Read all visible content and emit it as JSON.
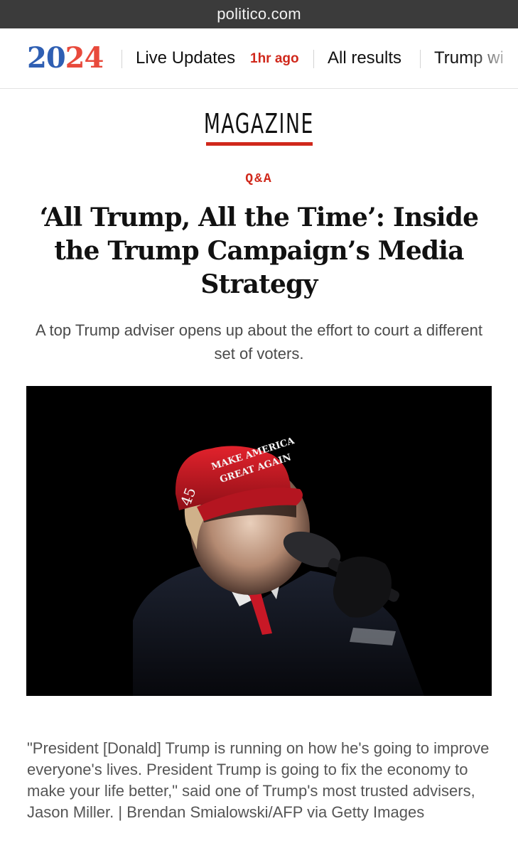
{
  "browser": {
    "url": "politico.com"
  },
  "election_nav": {
    "logo_prefix": "20",
    "logo_middle": "2",
    "logo_suffix": "4",
    "items": [
      {
        "label": "Live Updates",
        "badge": "1hr ago"
      },
      {
        "label": "All results"
      },
      {
        "label": "Trump wi"
      }
    ]
  },
  "section": {
    "label": "MAGAZINE"
  },
  "article": {
    "kicker": "Q&A",
    "headline": "‘All Trump, All the Time’: Inside the Trump Campaign’s Media Strategy",
    "dek": "A top Trump adviser opens up about the effort to court a different set of voters.",
    "image": {
      "hat_line1": "MAKE AMERICA",
      "hat_line2": "GREAT AGAIN",
      "hat_number": "45"
    },
    "caption": "\"President [Donald] Trump is running on how he's going to improve everyone's lives. President Trump is going to fix the economy to make your life better,\" said one of Trump's most trusted advisers, Jason Miller. | Brendan Smialowski/AFP via Getty Images"
  },
  "colors": {
    "accent_red": "#d0281b",
    "logo_blue": "#2f5fb3",
    "logo_red": "#e84a3c",
    "urlbar_bg": "#3b3b3b"
  }
}
